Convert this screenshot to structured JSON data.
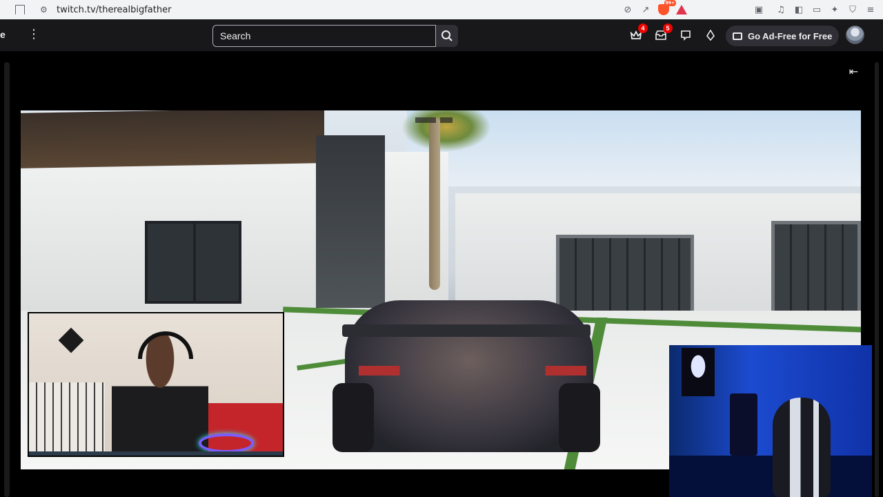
{
  "browser": {
    "url": "twitch.tv/therealbigfather",
    "extension_badge": "99+"
  },
  "twitch": {
    "logo_fragment": "e",
    "search_placeholder": "Search",
    "notifications": {
      "prime_count": "4",
      "inbox_count": "5"
    },
    "adfree_label": "Go Ad-Free for Free"
  },
  "player": {
    "collapse_icon": "arrow-collapse-icon"
  },
  "icons": {
    "bookmark": "bookmark-icon",
    "site_info": "site-info-icon",
    "no_tracking": "tracking-icon",
    "share": "share-icon",
    "brave": "brave-shield-icon",
    "rewards": "brave-rewards-icon",
    "reading": "reading-mode-icon",
    "media": "media-icon",
    "sidebar": "sidebar-icon",
    "wallet": "wallet-icon",
    "leo": "leo-ai-icon",
    "vpn": "vpn-icon",
    "menu": "menu-icon"
  },
  "colors": {
    "twitch_bg": "#18181b",
    "badge_red": "#eb0400",
    "brave_orange": "#fb542b"
  }
}
